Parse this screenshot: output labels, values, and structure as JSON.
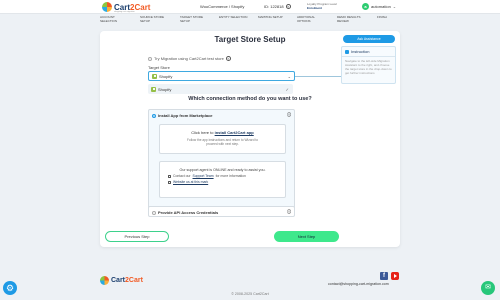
{
  "header": {
    "brand": {
      "part1": "Cart",
      "part2": "2Cart",
      "tagline": "shopping cart migration"
    },
    "migration_label": "WooCommerce / Shopify",
    "cart_id": "ID: 122818",
    "loyalty_line1": "Loyalty Program Level",
    "loyalty_line2": "Enrolment",
    "user_initial": "a",
    "user_name": "automation",
    "caret": "⌄"
  },
  "steps": [
    {
      "label": "ACCOUNT SELECTION"
    },
    {
      "label": "SOURCE STORE SETUP"
    },
    {
      "label": "TARGET STORE SETUP"
    },
    {
      "label": "ENTITY SELECTION"
    },
    {
      "label": "MAPPING SETUP"
    },
    {
      "label": "ADDITIONAL OPTIONS"
    },
    {
      "label": "DEMO RESULTS REVIEW"
    },
    {
      "label": "FINISH"
    }
  ],
  "main": {
    "title": "Target Store Setup",
    "ask_button": "Ask Assistance",
    "instruction_title": "Instruction",
    "instruction_text": "Navigate to the left-side Migration Assistant to the right, and choose the target store in the drop-down to get further instructions",
    "try_label": "Try Migration using Cart2Cart test store",
    "target_store_label": "Target Store",
    "target_store_value": "Shopify",
    "target_chevron": "⌄",
    "dropdown_option": "Shopify",
    "dropdown_check": "✓",
    "method_question": "Which connection method do you want to use?",
    "option1": {
      "title": "Install App from Marketplace",
      "click_prefix": "Click here to",
      "click_link": "install Cart2Cart app",
      "click_desc": "Follow the app instructions and return to Wizard to proceed with next step.",
      "support_text": "Our support agent is ONLINE and ready to assist you.",
      "contact_prefix": "Contact our",
      "contact_link": "Support Team",
      "contact_suffix": "for more information",
      "website_link": "Website us at this mark",
      "info_icon": "ⓘ"
    },
    "option2": {
      "title": "Provide API Access Credentials",
      "info_icon": "ⓘ"
    },
    "prev_button": "Previous Step",
    "next_button": "Next Step"
  },
  "footer": {
    "email": "contact@shopping-cart-migration.com",
    "copyright": "© 2008-2025 Cart2Cart",
    "fb": "f"
  },
  "floats": {
    "gear": "⚙",
    "chat": "✉"
  }
}
